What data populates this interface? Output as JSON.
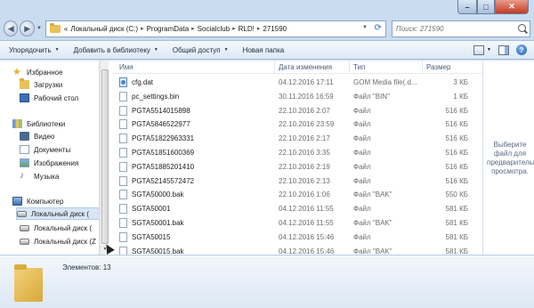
{
  "window": {
    "controls": {
      "minimize": "–",
      "maximize": "□",
      "close": "✕"
    }
  },
  "address": {
    "prefix": "«",
    "crumbs": [
      "Локальный диск (C:)",
      "ProgramData",
      "Socialclub",
      "RLD!",
      "271590"
    ],
    "separator": "▸"
  },
  "search": {
    "placeholder": "Поиск: 271590"
  },
  "toolbar": {
    "organize": "Упорядочить",
    "add_to_library": "Добавить в библиотеку",
    "share": "Общий доступ",
    "new_folder": "Новая папка"
  },
  "nav": {
    "favorites": "Избранное",
    "downloads": "Загрузки",
    "desktop": "Рабочий стол",
    "libraries": "Библиотеки",
    "video": "Видео",
    "documents": "Документы",
    "images": "Изображения",
    "music": "Музыка",
    "computer": "Компьютер",
    "drive1": "Локальный диск (",
    "drive2": "Локальный диск (",
    "drive3": "Локальный диск (Z"
  },
  "columns": {
    "name": "Имя",
    "date": "Дата изменения",
    "type": "Тип",
    "size": "Размер"
  },
  "files": [
    {
      "name": "cfg.dat",
      "date": "04.12.2016 17:11",
      "type": "GOM Media file(.d...",
      "size": "3 КБ",
      "icon": "gom-icon"
    },
    {
      "name": "pc_settings.bin",
      "date": "30.11.2016 16:59",
      "type": "Файл \"BIN\"",
      "size": "1 КБ",
      "icon": "file-icon"
    },
    {
      "name": "PGTA5514015898",
      "date": "22.10.2016 2:07",
      "type": "Файл",
      "size": "516 КБ",
      "icon": "file-icon"
    },
    {
      "name": "PGTA5846522977",
      "date": "22.10.2016 23:59",
      "type": "Файл",
      "size": "516 КБ",
      "icon": "file-icon"
    },
    {
      "name": "PGTA51822963331",
      "date": "22.10.2016 2:17",
      "type": "Файл",
      "size": "516 КБ",
      "icon": "file-icon"
    },
    {
      "name": "PGTA51851600369",
      "date": "22.10.2016 3:35",
      "type": "Файл",
      "size": "516 КБ",
      "icon": "file-icon"
    },
    {
      "name": "PGTA51885201410",
      "date": "22.10.2016 2:19",
      "type": "Файл",
      "size": "516 КБ",
      "icon": "file-icon"
    },
    {
      "name": "PGTA52145572472",
      "date": "22.10.2016 2:13",
      "type": "Файл",
      "size": "516 КБ",
      "icon": "file-icon"
    },
    {
      "name": "SGTA50000.bak",
      "date": "22.10.2016 1:06",
      "type": "Файл \"BAK\"",
      "size": "550 КБ",
      "icon": "file-icon"
    },
    {
      "name": "SGTA50001",
      "date": "04.12.2016 11:55",
      "type": "Файл",
      "size": "581 КБ",
      "icon": "file-icon"
    },
    {
      "name": "SGTA50001.bak",
      "date": "04.12.2016 11:55",
      "type": "Файл \"BAK\"",
      "size": "581 КБ",
      "icon": "file-icon"
    },
    {
      "name": "SGTA50015",
      "date": "04.12.2016 15:46",
      "type": "Файл",
      "size": "581 КБ",
      "icon": "file-icon"
    },
    {
      "name": "SGTA50015.bak",
      "date": "04.12.2016 15:46",
      "type": "Файл \"BAK\"",
      "size": "581 КБ",
      "icon": "file-icon"
    }
  ],
  "preview": {
    "message": "Выберите файл для предварительного просмотра."
  },
  "details": {
    "count": "Элементов: 13"
  }
}
